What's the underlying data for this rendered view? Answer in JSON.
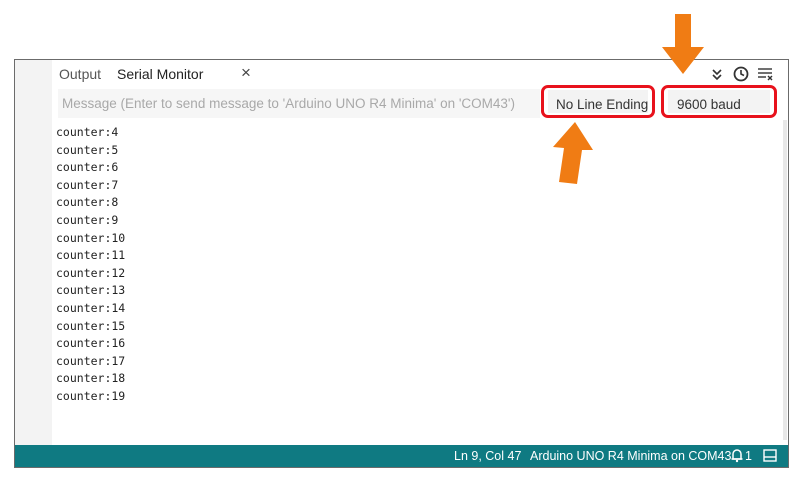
{
  "tabs": [
    {
      "label": "Output"
    },
    {
      "label": "Serial Monitor"
    }
  ],
  "message_input": {
    "placeholder": "Message (Enter to send message to 'Arduino UNO R4 Minima' on 'COM43')"
  },
  "line_ending_select": {
    "selected": "No Line Ending"
  },
  "baud_select": {
    "selected": "9600 baud"
  },
  "output_lines": [
    "counter:4",
    "counter:5",
    "counter:6",
    "counter:7",
    "counter:8",
    "counter:9",
    "counter:10",
    "counter:11",
    "counter:12",
    "counter:13",
    "counter:14",
    "counter:15",
    "counter:16",
    "counter:17",
    "counter:18",
    "counter:19"
  ],
  "status_bar": {
    "cursor": "Ln 9, Col 47",
    "board": "Arduino UNO R4 Minima on COM43",
    "notifications": "1"
  },
  "icons": {
    "close": "close-icon",
    "toggle_autoscroll": "chevrons-down-icon",
    "timestamp": "clock-icon",
    "clear": "clear-output-icon",
    "bell": "bell-icon",
    "panel": "panel-icon"
  },
  "colors": {
    "status_bar": "#0f7a82",
    "highlight_border": "#e8121c",
    "arrow": "#f07c14"
  }
}
